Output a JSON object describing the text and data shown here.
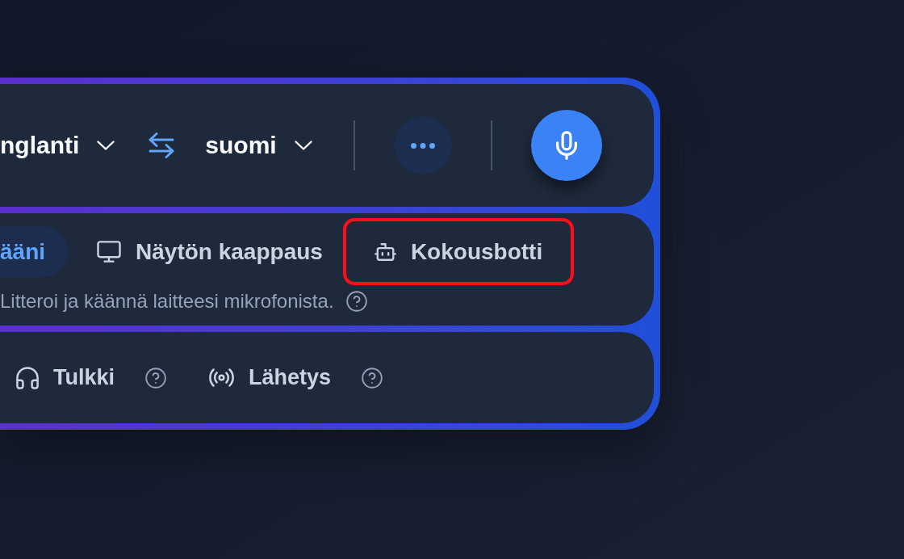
{
  "language_bar": {
    "source_language": "nglanti",
    "target_language": "suomi"
  },
  "source_tabs": [
    {
      "label": "ääni",
      "selected": true,
      "highlighted": false
    },
    {
      "label": "Näytön kaappaus",
      "selected": false,
      "highlighted": false
    },
    {
      "label": "Kokousbotti",
      "selected": false,
      "highlighted": true
    }
  ],
  "source_description": "Litteroi ja käännä laitteesi mikrofonista.",
  "modes": [
    {
      "label": "Tulkki"
    },
    {
      "label": "Lähetys"
    }
  ]
}
